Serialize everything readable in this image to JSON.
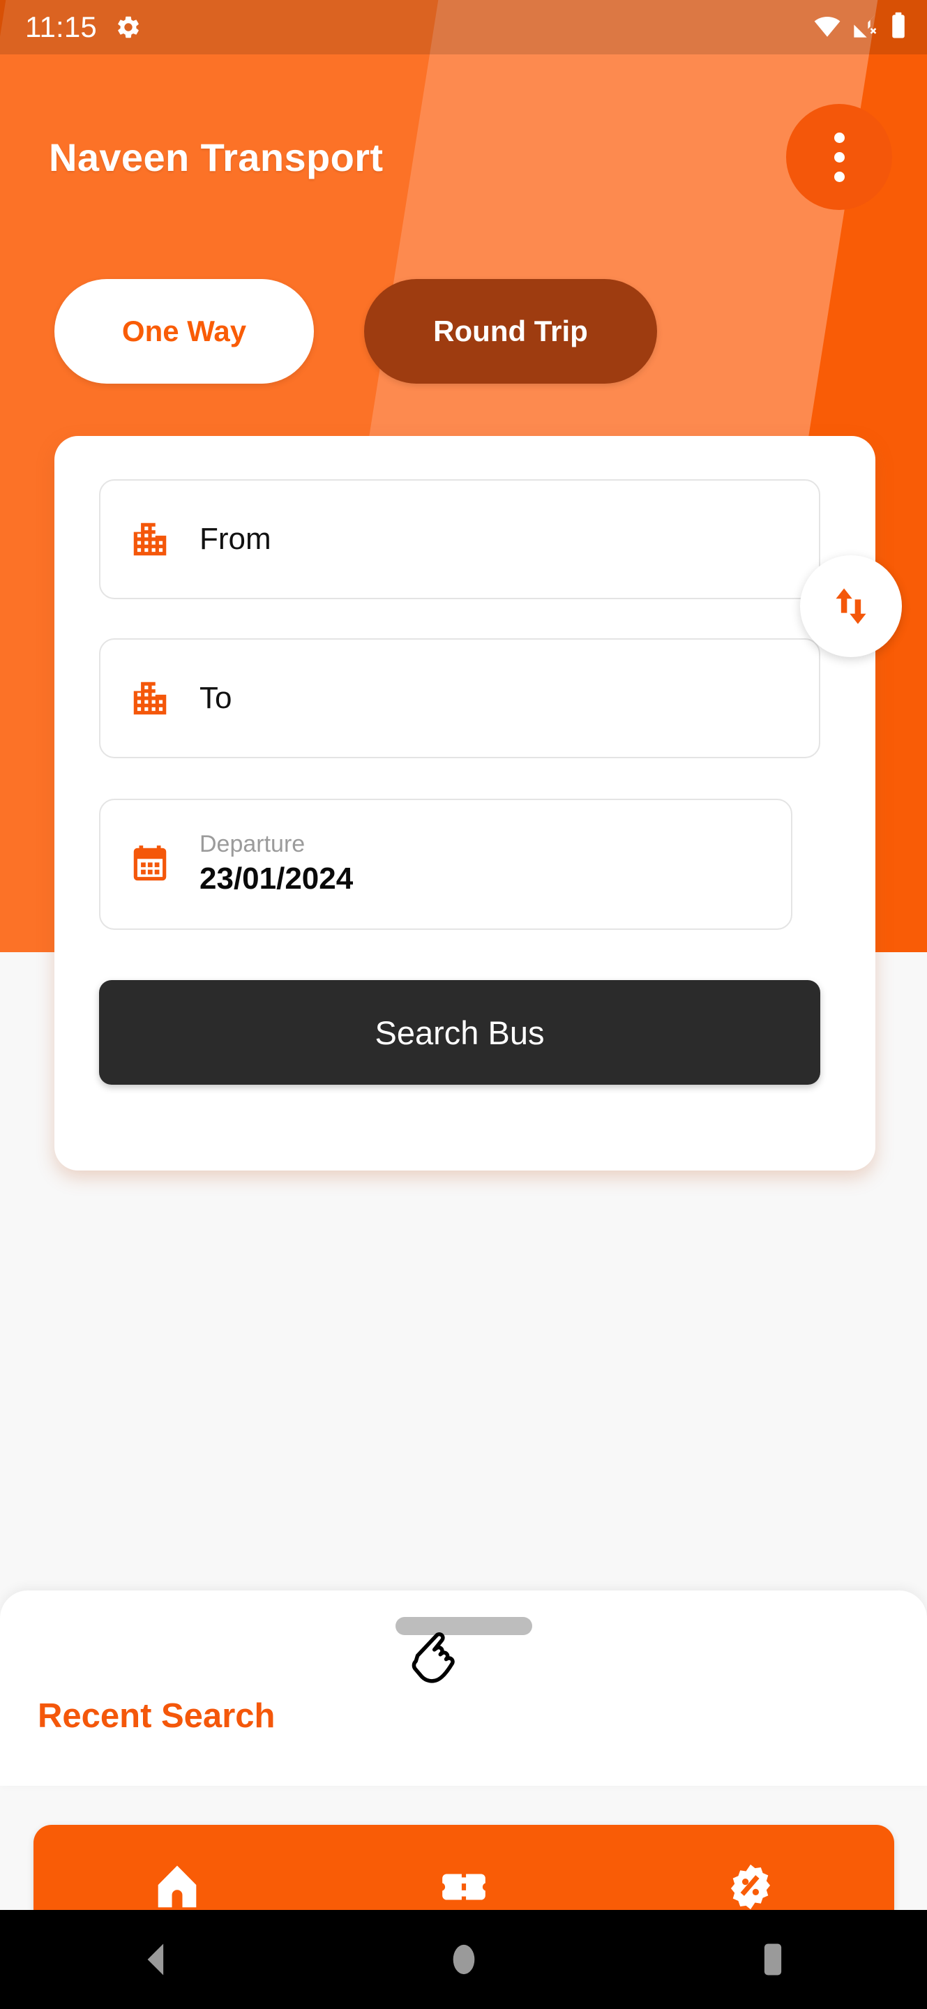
{
  "status_bar": {
    "time": "11:15",
    "icons": [
      "gear-icon",
      "wifi-icon",
      "cellular-off-icon",
      "battery-icon"
    ]
  },
  "app_bar": {
    "title": "Naveen Transport",
    "overflow_menu_icon": "three-dot-menu-icon"
  },
  "trip_tabs": [
    {
      "label": "One Way",
      "active": true
    },
    {
      "label": "Round Trip",
      "active": false
    }
  ],
  "search_form": {
    "from": {
      "label": "From",
      "icon": "buildings-icon"
    },
    "to": {
      "label": "To",
      "icon": "buildings-icon"
    },
    "swap_icon": "swap-vertical-arrows-icon",
    "departure": {
      "label": "Departure",
      "value": "23/01/2024",
      "icon": "calendar-icon"
    },
    "submit_label": "Search Bus"
  },
  "bottom_sheet": {
    "title": "Recent Search",
    "handle_icon": "drag-handle-icon",
    "pointer_icon": "hand-pointer-icon"
  },
  "bottom_nav": [
    {
      "icon": "home-icon",
      "active": true
    },
    {
      "icon": "ticket-icon",
      "active": false
    },
    {
      "icon": "offer-percent-icon",
      "active": false
    }
  ],
  "android_nav": [
    {
      "icon": "back-triangle-icon"
    },
    {
      "icon": "home-circle-icon"
    },
    {
      "icon": "recents-square-icon"
    }
  ],
  "colors": {
    "primary_orange": "#F95C06",
    "band_mid": "#FC7227",
    "band_light": "#FD8A4F",
    "tab_inactive": "#9E3C10",
    "button_dark": "#2B2B2B",
    "accent_text": "#F4570A",
    "muted_text": "#9B9B9B"
  }
}
